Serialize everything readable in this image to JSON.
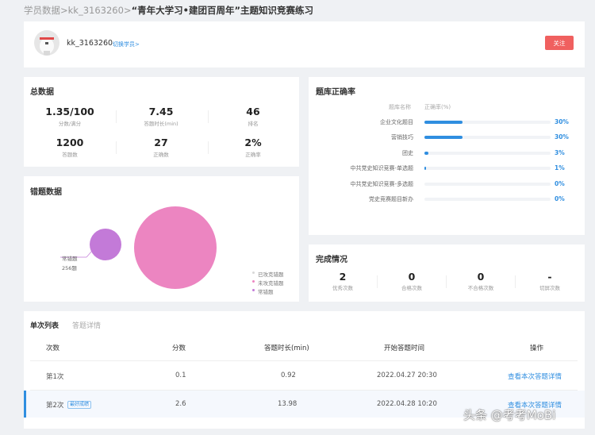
{
  "breadcrumb": {
    "parent": "学员数据>kk_3163260>",
    "current": "“青年大学习•建团百周年”主题知识竞赛练习"
  },
  "profile": {
    "username": "kk_3163260",
    "switch_label": "切换学员>",
    "follow_label": "关注"
  },
  "summary": {
    "title": "总数据",
    "stats": [
      {
        "value": "1.35/100",
        "label": "分数/满分"
      },
      {
        "value": "7.45",
        "label": "答题时长(min)"
      },
      {
        "value": "46",
        "label": "排名"
      },
      {
        "value": "1200",
        "label": "答题数"
      },
      {
        "value": "27",
        "label": "正确数"
      },
      {
        "value": "2%",
        "label": "正确率"
      }
    ]
  },
  "accuracy": {
    "title": "题库正确率",
    "header_name": "题库名称",
    "header_rate": "正确率(%)",
    "rows": [
      {
        "name": "企业文化题目",
        "rate": 30,
        "label": "30%"
      },
      {
        "name": "营销技巧",
        "rate": 30,
        "label": "30%"
      },
      {
        "name": "团史",
        "rate": 3,
        "label": "3%"
      },
      {
        "name": "中共党史知识竞赛-单选题",
        "rate": 1,
        "label": "1%"
      },
      {
        "name": "中共党史知识竞赛-多选题",
        "rate": 0,
        "label": "0%"
      },
      {
        "name": "党史竞赛题目新办",
        "rate": 0,
        "label": "0%"
      }
    ]
  },
  "errors": {
    "title": "错题数据",
    "callout_name": "常错题",
    "callout_value": "256题",
    "legend": [
      {
        "label": "已攻克错题",
        "color": "#d8d8d8"
      },
      {
        "label": "未攻克错题",
        "color": "#ec85c1"
      },
      {
        "label": "常错题",
        "color": "#c37ad8"
      }
    ]
  },
  "completion": {
    "title": "完成情况",
    "stats": [
      {
        "value": "2",
        "label": "优秀次数"
      },
      {
        "value": "0",
        "label": "合格次数"
      },
      {
        "value": "0",
        "label": "不合格次数"
      },
      {
        "value": "-",
        "label": "切屏次数"
      }
    ]
  },
  "attempts": {
    "tab_active": "单次列表",
    "tab_inactive": "答题详情",
    "columns": [
      "次数",
      "分数",
      "答题时长(min)",
      "开始答题时间",
      "操作"
    ],
    "rows": [
      {
        "attempt": "第1次",
        "badge": "",
        "score": "0.1",
        "duration": "0.92",
        "start": "2022.04.27 20:30",
        "action": "查看本次答题详情"
      },
      {
        "attempt": "第2次",
        "badge": "最好成绩",
        "score": "2.6",
        "duration": "13.98",
        "start": "2022.04.28 10:20",
        "action": "查看本次答题详情"
      }
    ]
  },
  "watermark": "头条 @考考MoBi",
  "colors": {
    "accent": "#2f8ee0",
    "follow": "#f0605f",
    "bubble_large": "#ec85c1",
    "bubble_small": "#c37ad8"
  }
}
